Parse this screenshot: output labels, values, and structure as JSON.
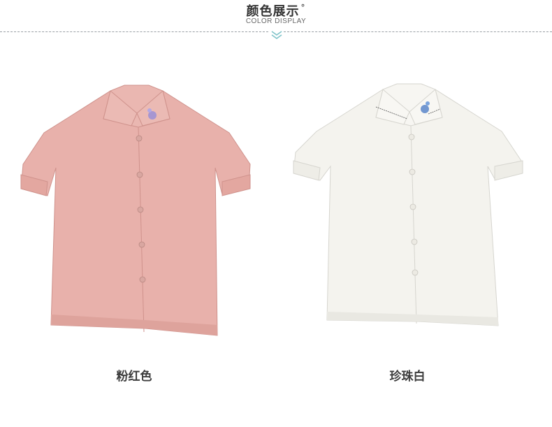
{
  "header": {
    "title": "颜色展示",
    "title_mark": "°",
    "subtitle": "COLOR DISPLAY"
  },
  "products": [
    {
      "label": "粉红色",
      "color": "#e8b1ab",
      "shade": "#cf928c",
      "embroidery": "#9b8fd6"
    },
    {
      "label": "珍珠白",
      "color": "#f4f3ee",
      "shade": "#d6d5cf",
      "embroidery": "#5a86c9"
    }
  ],
  "colors": {
    "accent": "#7fc3c9",
    "divider": "#9aa0a6"
  }
}
